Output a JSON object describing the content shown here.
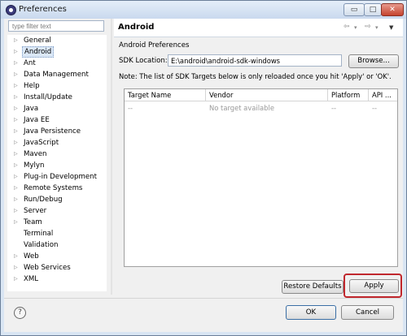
{
  "window": {
    "title": "Preferences",
    "min": "▭",
    "max": "□",
    "close": "✕"
  },
  "filter": {
    "placeholder": "type filter text"
  },
  "tree": {
    "items": [
      {
        "label": "General",
        "expandable": true
      },
      {
        "label": "Android",
        "expandable": true,
        "selected": true
      },
      {
        "label": "Ant",
        "expandable": true
      },
      {
        "label": "Data Management",
        "expandable": true
      },
      {
        "label": "Help",
        "expandable": true
      },
      {
        "label": "Install/Update",
        "expandable": true
      },
      {
        "label": "Java",
        "expandable": true
      },
      {
        "label": "Java EE",
        "expandable": true
      },
      {
        "label": "Java Persistence",
        "expandable": true
      },
      {
        "label": "JavaScript",
        "expandable": true
      },
      {
        "label": "Maven",
        "expandable": true
      },
      {
        "label": "Mylyn",
        "expandable": true
      },
      {
        "label": "Plug-in Development",
        "expandable": true
      },
      {
        "label": "Remote Systems",
        "expandable": true
      },
      {
        "label": "Run/Debug",
        "expandable": true
      },
      {
        "label": "Server",
        "expandable": true
      },
      {
        "label": "Team",
        "expandable": true
      },
      {
        "label": "Terminal",
        "expandable": false
      },
      {
        "label": "Validation",
        "expandable": false
      },
      {
        "label": "Web",
        "expandable": true
      },
      {
        "label": "Web Services",
        "expandable": true
      },
      {
        "label": "XML",
        "expandable": true
      }
    ]
  },
  "panel": {
    "title": "Android",
    "nav": {
      "back": "⇦",
      "forward": "⇨",
      "dropdown": "▾",
      "menu": "▼"
    },
    "section_label": "Android Preferences",
    "sdk_location_label": "SDK Location:",
    "sdk_location_value": "E:\\android\\android-sdk-windows",
    "browse_label": "Browse...",
    "note": "Note: The list of SDK Targets below is only reloaded once you hit 'Apply' or 'OK'.",
    "table": {
      "headers": [
        "Target Name",
        "Vendor",
        "Platform",
        "API ..."
      ],
      "rows": [
        [
          "--",
          "No target available",
          "--",
          "--"
        ]
      ]
    },
    "restore_defaults_label": "Restore Defaults",
    "apply_label": "Apply"
  },
  "footer": {
    "help_icon": "?",
    "ok_label": "OK",
    "cancel_label": "Cancel"
  },
  "colors": {
    "highlight": "#c0272d",
    "selection": "#dbe8f7"
  }
}
